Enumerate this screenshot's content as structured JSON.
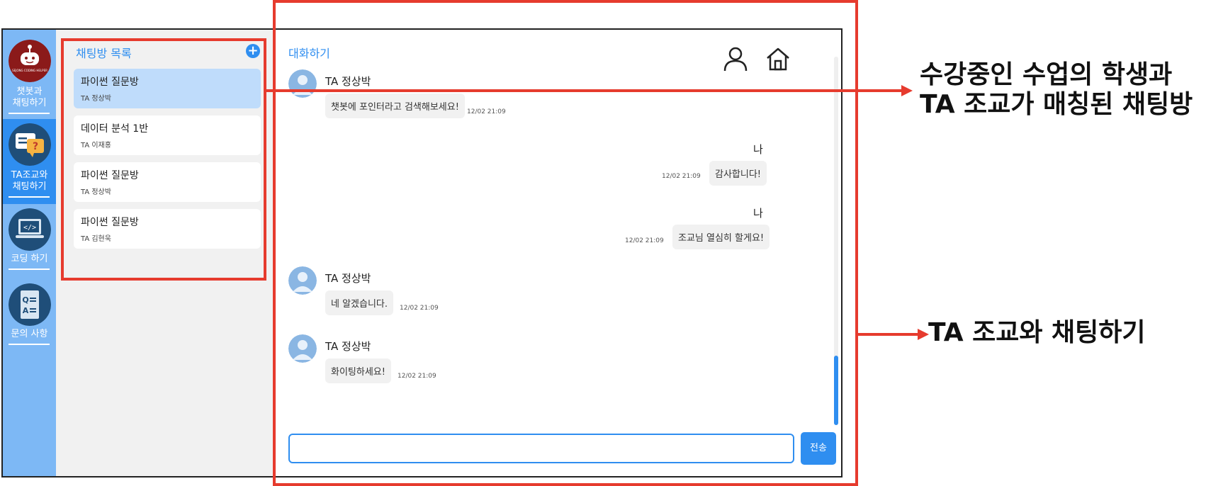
{
  "nav": {
    "items": [
      {
        "label_1": "챗봇과",
        "label_2": "채팅하기",
        "logo_text": "SEJONG CODING HELPER"
      },
      {
        "label_1": "TA조교와",
        "label_2": "채팅하기"
      },
      {
        "label_1": "코딩 하기",
        "label_2": ""
      },
      {
        "label_1": "문의 사항",
        "label_2": ""
      }
    ]
  },
  "room_list": {
    "title": "채팅방 목록",
    "add_label": "+",
    "rooms": [
      {
        "name": "파이썬 질문방",
        "ta": "TA 정상박"
      },
      {
        "name": "데이터 분석 1반",
        "ta": "TA 이재홍"
      },
      {
        "name": "파이썬 질문방",
        "ta": "TA 정상박"
      },
      {
        "name": "파이썬 질문방",
        "ta": "TA 김현욱"
      }
    ]
  },
  "chat": {
    "title": "대화하기",
    "messages": [
      {
        "sender": "TA 정상박",
        "text": "챗봇에 포인터라고 검색해보세요!",
        "time": "12/02 21:09",
        "mine": false
      },
      {
        "sender": "나",
        "text": "감사합니다!",
        "time": "12/02 21:09",
        "mine": true
      },
      {
        "sender": "나",
        "text": "조교님 열심히 할게요!",
        "time": "12/02 21:09",
        "mine": true
      },
      {
        "sender": "TA 정상박",
        "text": "네 알겠습니다.",
        "time": "12/02 21:09",
        "mine": false
      },
      {
        "sender": "TA 정상박",
        "text": "화이팅하세요!",
        "time": "12/02 21:09",
        "mine": false
      }
    ],
    "input_value": "",
    "send_label": "전송"
  },
  "annotations": {
    "room_note_line1": "수강중인 수업의 학생과",
    "room_note_line2": "TA 조교가 매칭된 채팅방",
    "chat_note": "TA 조교와 채팅하기"
  },
  "colors": {
    "accent": "#2f8ef0",
    "nav_bg": "#7db8f5",
    "highlight": "#e63b2e"
  }
}
